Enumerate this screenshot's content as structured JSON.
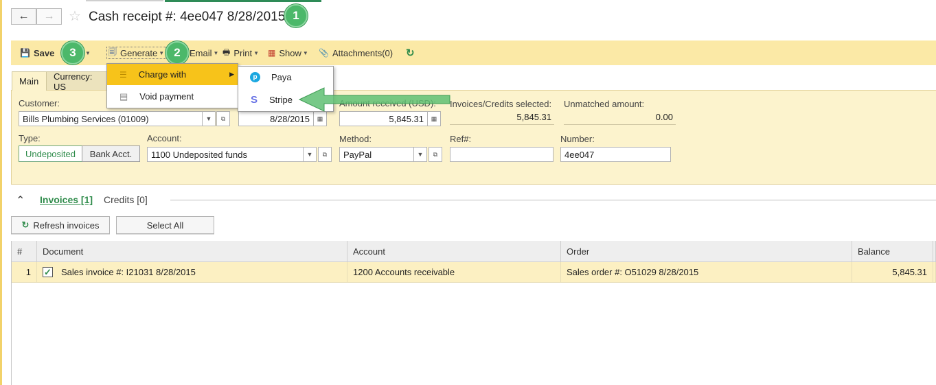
{
  "header": {
    "title": "Cash receipt #: 4ee047 8/28/2015",
    "back_icon": "arrow-left-icon",
    "forward_icon": "arrow-right-icon",
    "favorite_icon": "star-icon"
  },
  "callouts": {
    "c1": "1",
    "c2": "2",
    "c3": "3"
  },
  "toolbar": {
    "save": "Save",
    "generate": "Generate",
    "email": "Email",
    "print": "Print",
    "show": "Show",
    "attachments": "Attachments(0)"
  },
  "generate_menu": {
    "items": [
      {
        "label": "Charge with",
        "icon": "coins-icon",
        "highlighted": true
      },
      {
        "label": "Void payment",
        "icon": "document-icon"
      }
    ]
  },
  "charge_submenu": {
    "items": [
      {
        "label": "Paya",
        "icon": "paya-icon"
      },
      {
        "label": "Stripe",
        "icon": "stripe-icon"
      }
    ]
  },
  "tabs": {
    "main": "Main",
    "currency": "Currency: US"
  },
  "form": {
    "customer_label": "Customer:",
    "customer_value": "Bills Plumbing Services (01009)",
    "date_value": "8/28/2015",
    "amount_label": "Amount received (USD):",
    "amount_value": "5,845.31",
    "selected_label": "Invoices/Credits selected:",
    "selected_value": "5,845.31",
    "unmatched_label": "Unmatched amount:",
    "unmatched_value": "0.00",
    "type_label": "Type:",
    "type_undeposited": "Undeposited",
    "type_bank": "Bank Acct.",
    "account_label": "Account:",
    "account_value": "1100 Undeposited funds",
    "method_label": "Method:",
    "method_value": "PayPal",
    "ref_label": "Ref#:",
    "ref_value": "",
    "number_label": "Number:",
    "number_value": "4ee047"
  },
  "section": {
    "invoices_tab": "Invoices [1]",
    "credits_tab": "Credits [0]",
    "refresh_button": "Refresh invoices",
    "select_all_button": "Select All"
  },
  "grid": {
    "columns": [
      "#",
      "Document",
      "Account",
      "Order",
      "Balance"
    ],
    "rows": [
      {
        "num": "1",
        "checked": true,
        "document": "Sales invoice #: I21031 8/28/2015",
        "account": "1200 Accounts receivable",
        "order": "Sales order #: O51029 8/28/2015",
        "balance": "5,845.31"
      }
    ]
  },
  "colors": {
    "accent": "#2e8b4a",
    "toolbar": "#fbe9a6",
    "form": "#fcf3cd",
    "highlight": "#f7c31a",
    "callout": "#4cb86a"
  }
}
